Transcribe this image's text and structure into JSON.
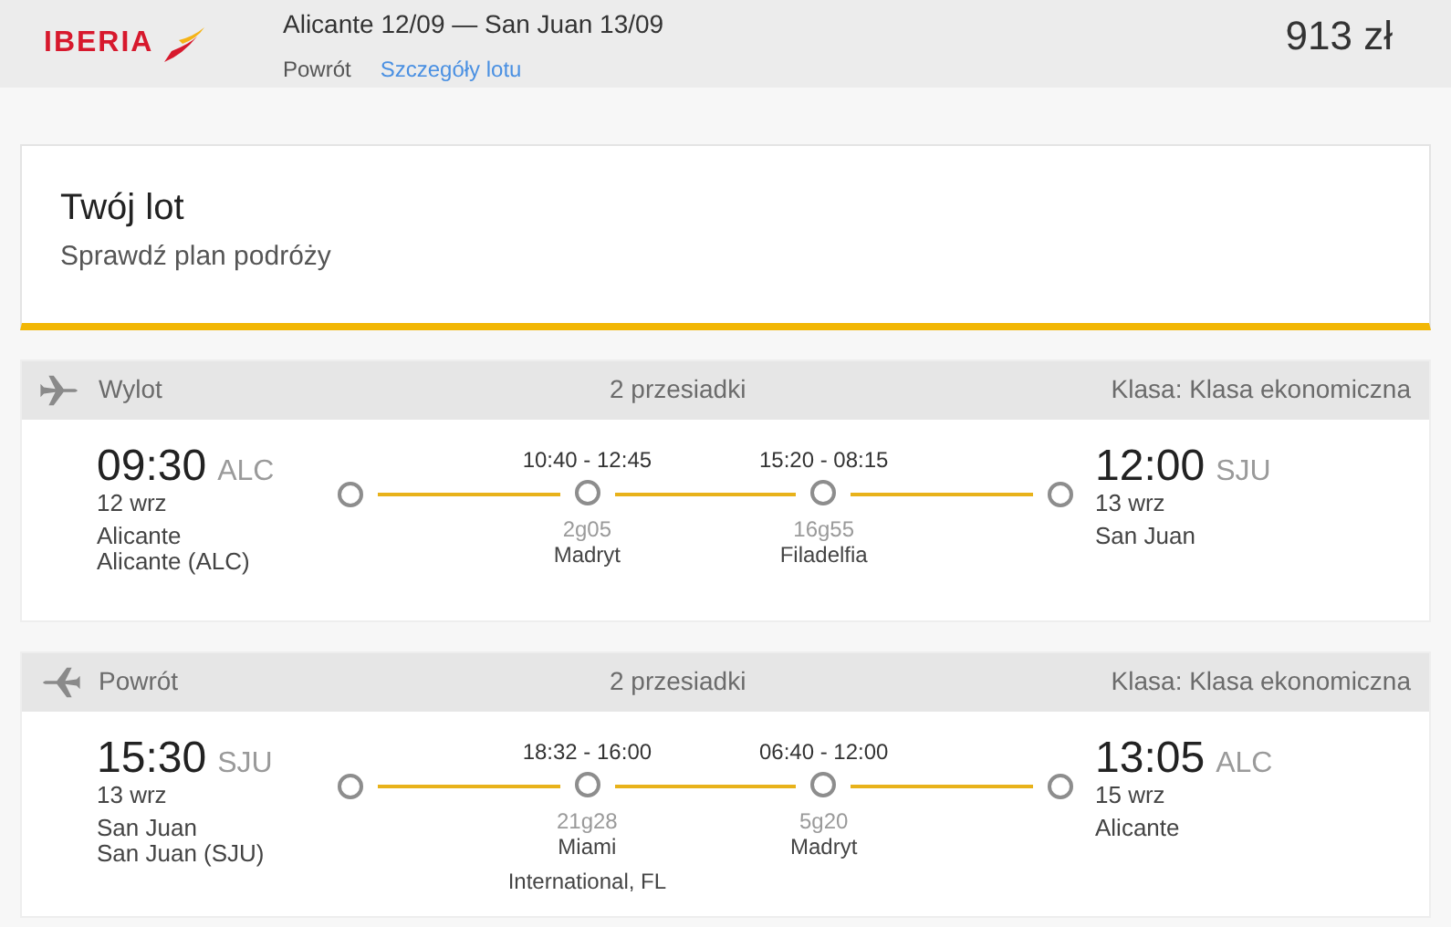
{
  "header": {
    "logo": "IBERIA",
    "route": "Alicante 12/09 — San Juan 13/09",
    "trip_type": "Powrót",
    "details_link": "Szczegóły lotu",
    "price": "913 zł"
  },
  "intro": {
    "title": "Twój lot",
    "subtitle": "Sprawdź plan podróży"
  },
  "legs": [
    {
      "kind": "outbound",
      "label": "Wylot",
      "stops_label": "2 przesiadki",
      "class_label": "Klasa: Klasa ekonomiczna",
      "depart": {
        "time": "09:30",
        "code": "ALC",
        "date": "12 wrz",
        "city": "Alicante",
        "airport": "Alicante (ALC)"
      },
      "arrive": {
        "time": "12:00",
        "code": "SJU",
        "date": "13 wrz",
        "city": "San Juan"
      },
      "stops": [
        {
          "times": "10:40 - 12:45",
          "duration": "2g05",
          "city": "Madryt"
        },
        {
          "times": "15:20 - 08:15",
          "duration": "16g55",
          "city": "Filadelfia"
        }
      ]
    },
    {
      "kind": "return",
      "label": "Powrót",
      "stops_label": "2 przesiadki",
      "class_label": "Klasa: Klasa ekonomiczna",
      "depart": {
        "time": "15:30",
        "code": "SJU",
        "date": "13 wrz",
        "city": "San Juan",
        "airport": "San Juan (SJU)"
      },
      "arrive": {
        "time": "13:05",
        "code": "ALC",
        "date": "15 wrz",
        "city": "Alicante"
      },
      "stops": [
        {
          "times": "18:32 - 16:00",
          "duration": "21g28",
          "city": "Miami",
          "extra": "International, FL"
        },
        {
          "times": "06:40 - 12:00",
          "duration": "5g20",
          "city": "Madryt"
        }
      ]
    }
  ]
}
